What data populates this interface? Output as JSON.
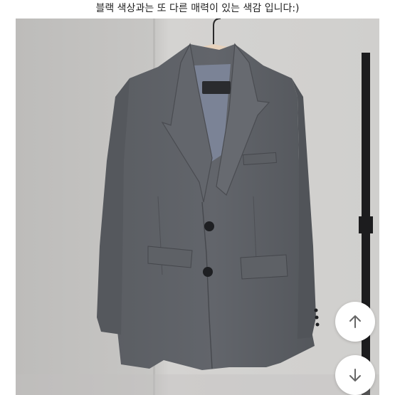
{
  "caption": {
    "text": "블랙 색상과는 또 다른 매력이 있는 색감 입니다:)"
  },
  "photo": {
    "subject": "gray-blazer-on-hanger"
  },
  "controls": {
    "scroll_up_icon": "arrow-up-icon",
    "scroll_down_icon": "arrow-down-icon"
  },
  "colors": {
    "wall": "#c9c8c6",
    "blazer": "#5d6066",
    "lining": "#7b8396",
    "hanger": "#e6d2bd",
    "button_bg": "#ffffff",
    "icon_stroke": "#666666"
  }
}
